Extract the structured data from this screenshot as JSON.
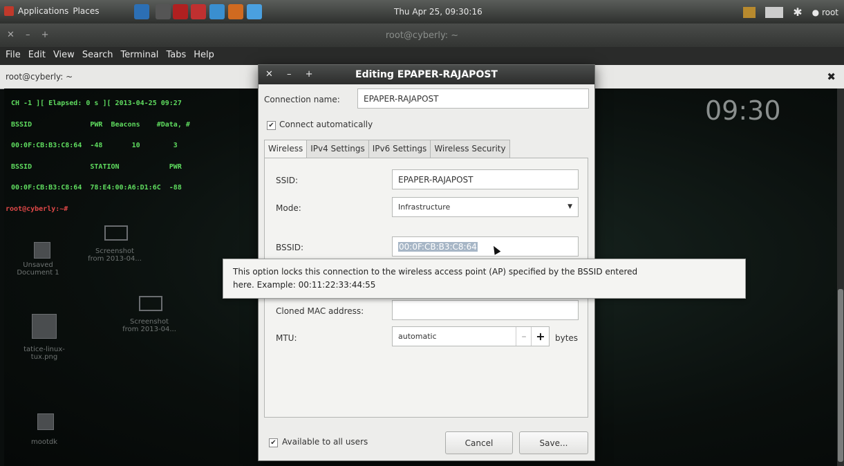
{
  "top_panel": {
    "applications": "Applications",
    "places": "Places",
    "clock": "Thu Apr 25, 09:30:16",
    "user": "root",
    "launchers": [
      "#2c6fb5",
      "#555",
      "#b02020",
      "#c03030",
      "#3a8fd0",
      "#d06a20",
      "#4aa0e0"
    ]
  },
  "terminal": {
    "window_title": "root@cyberly: ~",
    "menu": [
      "File",
      "Edit",
      "View",
      "Search",
      "Terminal",
      "Tabs",
      "Help"
    ],
    "tab_label": "root@cyberly: ~",
    "lines": [
      "CH -1 ][ Elapsed: 0 s ][ 2013-04-25 09:27",
      "BSSID              PWR  Beacons    #Data, #",
      "00:0F:CB:B3:C8:64  -48       10        3",
      "BSSID              STATION            PWR",
      "00:0F:CB:B3:C8:64  78:E4:00:A6:D1:6C  -88",
      "root@cyberly:~# "
    ]
  },
  "desktop": {
    "labels": [
      "Screenshot from 2013-04...",
      "Unsaved Document 1",
      "Screenshot from 2013-04...",
      "tatice-linux-tux.png",
      "mootdk"
    ]
  },
  "widget": {
    "time": "09:30"
  },
  "dialog": {
    "title": "Editing EPAPER-RAJAPOST",
    "connection_name_label": "Connection name:",
    "connection_name_value": "EPAPER-RAJAPOST",
    "connect_auto_label": "Connect automatically",
    "tabs": [
      "Wireless",
      "IPv4 Settings",
      "IPv6 Settings",
      "Wireless Security"
    ],
    "ssid_label": "SSID:",
    "ssid_value": "EPAPER-RAJAPOST",
    "mode_label": "Mode:",
    "mode_value": "Infrastructure",
    "bssid_label": "BSSID:",
    "bssid_value": "00:0F:CB:B3:C8:64",
    "cloned_mac_label": "Cloned MAC address:",
    "cloned_mac_value": "",
    "mtu_label": "MTU:",
    "mtu_value": "automatic",
    "mtu_unit": "bytes",
    "available_all_label": "Available to all users",
    "cancel": "Cancel",
    "save": "Save..."
  },
  "tooltip": {
    "line1": "This option locks this connection to the wireless access point (AP) specified by the BSSID entered",
    "line2": "here.  Example: 00:11:22:33:44:55"
  }
}
